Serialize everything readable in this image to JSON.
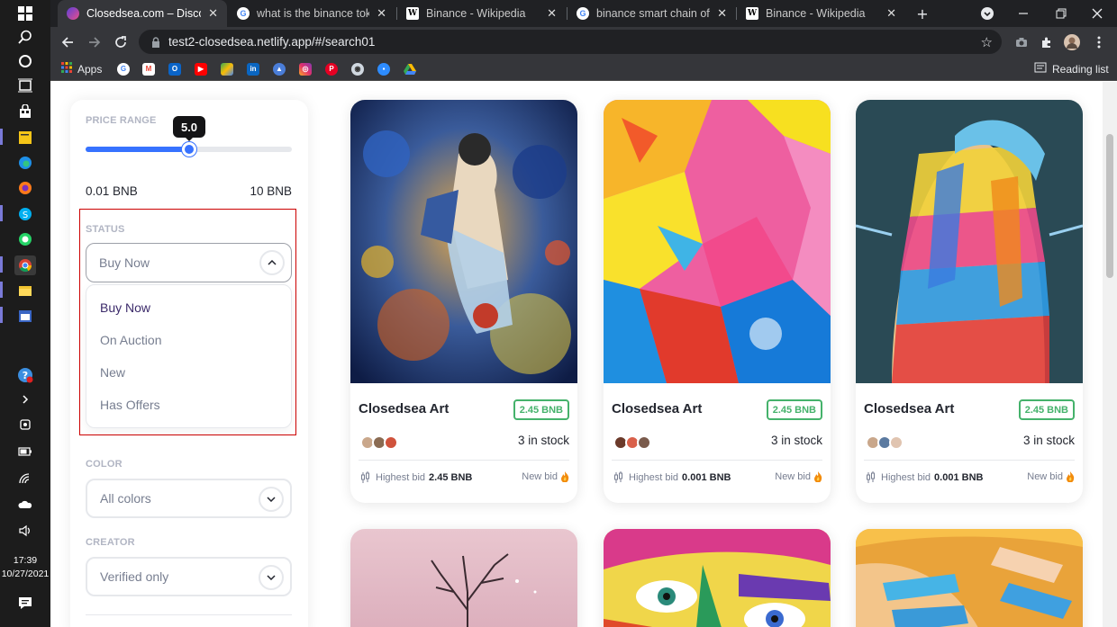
{
  "taskbar": {
    "icons": [
      "windows-icon",
      "search-icon",
      "cortana-icon",
      "task-view-icon",
      "store-icon",
      "sticky-notes-icon",
      "edge-icon",
      "firefox-icon",
      "skype-icon",
      "whatsapp-icon",
      "chrome-icon",
      "file-explorer-icon",
      "calendar-icon"
    ],
    "time": "17:39",
    "date": "10/27/2021"
  },
  "browser": {
    "tabs": [
      {
        "title": "Closedsea.com – Discover T",
        "active": true,
        "favicon": "closedsea-logo-icon"
      },
      {
        "title": "what is the binance token",
        "active": false,
        "favicon": "google-icon"
      },
      {
        "title": "Binance - Wikipedia",
        "active": false,
        "favicon": "wikipedia-icon"
      },
      {
        "title": "binance smart chain officia",
        "active": false,
        "favicon": "google-icon"
      },
      {
        "title": "Binance - Wikipedia",
        "active": false,
        "favicon": "wikipedia-icon"
      }
    ],
    "url": "test2-closedsea.netlify.app/#/search01",
    "bookmarks": {
      "apps_label": "Apps",
      "reading_list_label": "Reading list",
      "icons": [
        "google-icon",
        "gmail-icon",
        "outlook-icon",
        "youtube-icon",
        "maps-icon",
        "linkedin-icon",
        "classroom-icon",
        "instagram-icon",
        "pinterest-icon",
        "app-icon",
        "zoom-icon",
        "drive-icon"
      ]
    }
  },
  "filters": {
    "price_range": {
      "label": "PRICE RANGE",
      "value": "5.0",
      "value_fraction": 0.5,
      "min_label": "0.01 BNB",
      "max_label": "10 BNB"
    },
    "status": {
      "label": "STATUS",
      "selected": "Buy Now",
      "options": [
        "Buy Now",
        "On Auction",
        "New",
        "Has Offers"
      ]
    },
    "color": {
      "label": "COLOR",
      "selected": "All colors"
    },
    "creator": {
      "label": "CREATOR",
      "selected": "Verified only"
    }
  },
  "cards": [
    {
      "name": "Closedsea Art",
      "price": "2.45 BNB",
      "stock": "3 in stock",
      "highest_bid_label": "Highest bid",
      "highest_bid_value": "2.45 BNB",
      "new_bid_label": "New bid"
    },
    {
      "name": "Closedsea Art",
      "price": "2.45 BNB",
      "stock": "3 in stock",
      "highest_bid_label": "Highest bid",
      "highest_bid_value": "0.001 BNB",
      "new_bid_label": "New bid"
    },
    {
      "name": "Closedsea Art",
      "price": "2.45 BNB",
      "stock": "3 in stock",
      "highest_bid_label": "Highest bid",
      "highest_bid_value": "0.001 BNB",
      "new_bid_label": "New bid"
    }
  ],
  "colors": {
    "accent_blue": "#3772ff",
    "price_green": "#45b26b",
    "dark_text": "#23262f",
    "muted_text": "#777e90"
  }
}
